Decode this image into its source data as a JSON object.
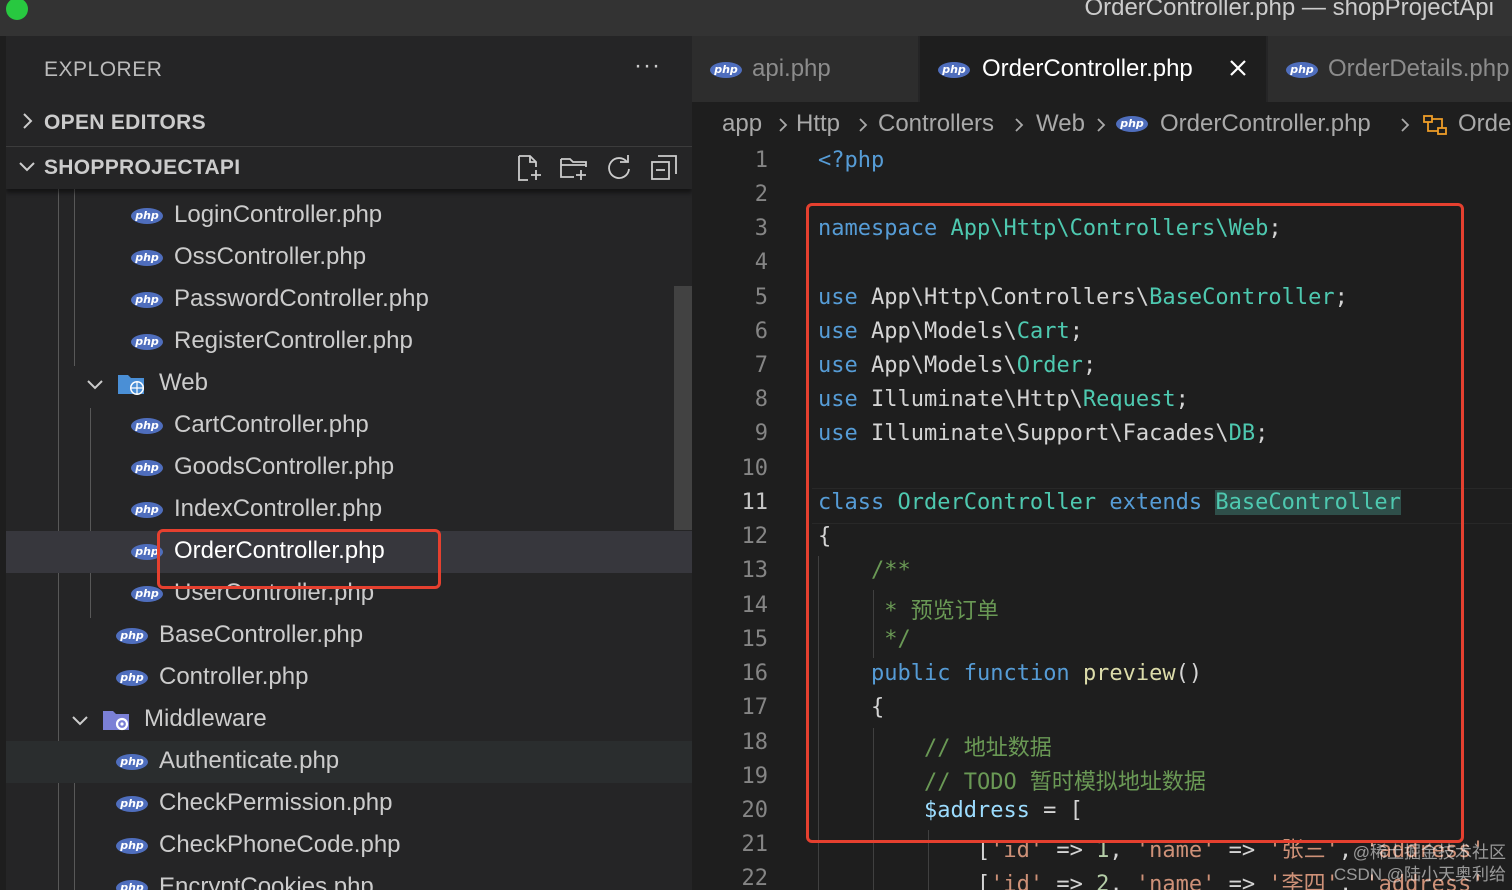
{
  "window": {
    "title": "OrderController.php — shopProjectApi"
  },
  "sidebar": {
    "title": "EXPLORER",
    "more": "···",
    "open_editors": "OPEN EDITORS",
    "project": "SHOPPROJECTAPI",
    "toolbar": [
      "new-file-icon",
      "new-folder-icon",
      "refresh-icon",
      "collapse-all-icon"
    ],
    "tree": [
      {
        "label": "LoginController.php",
        "type": "file"
      },
      {
        "label": "OssController.php",
        "type": "file"
      },
      {
        "label": "PasswordController.php",
        "type": "file"
      },
      {
        "label": "RegisterController.php",
        "type": "file"
      },
      {
        "label": "Web",
        "type": "folder",
        "expanded": true
      },
      {
        "label": "CartController.php",
        "type": "file"
      },
      {
        "label": "GoodsController.php",
        "type": "file"
      },
      {
        "label": "IndexController.php",
        "type": "file"
      },
      {
        "label": "OrderController.php",
        "type": "file",
        "selected": true
      },
      {
        "label": "UserController.php",
        "type": "file"
      },
      {
        "label": "BaseController.php",
        "type": "file"
      },
      {
        "label": "Controller.php",
        "type": "file"
      },
      {
        "label": "Middleware",
        "type": "folder",
        "expanded": true
      },
      {
        "label": "Authenticate.php",
        "type": "file"
      },
      {
        "label": "CheckPermission.php",
        "type": "file"
      },
      {
        "label": "CheckPhoneCode.php",
        "type": "file"
      },
      {
        "label": "EncryptCookies.php",
        "type": "file"
      }
    ]
  },
  "tabs": [
    {
      "label": "api.php",
      "active": false
    },
    {
      "label": "OrderController.php",
      "active": true
    },
    {
      "label": "OrderDetails.php",
      "active": false
    }
  ],
  "breadcrumbs": [
    "app",
    "Http",
    "Controllers",
    "Web",
    "OrderController.php",
    "OrderController"
  ],
  "editor": {
    "current_line": 11,
    "line_numbers": [
      "1",
      "2",
      "3",
      "4",
      "5",
      "6",
      "7",
      "8",
      "9",
      "10",
      "11",
      "12",
      "13",
      "14",
      "15",
      "16",
      "17",
      "18",
      "19",
      "20",
      "21",
      "22"
    ],
    "code": {
      "l1": "<?php",
      "l3_kw": "namespace",
      "l3_ns": "App\\Http\\Controllers\\Web",
      "l5_path": "App\\Http\\Controllers\\",
      "l5_cls": "BaseController",
      "l6_path": "App\\Models\\",
      "l6_cls": "Cart",
      "l7_path": "App\\Models\\",
      "l7_cls": "Order",
      "l8_path": "Illuminate\\Http\\",
      "l8_cls": "Request",
      "l9_path": "Illuminate\\Support\\Facades\\",
      "l9_cls": "DB",
      "use": "use",
      "l11_class": "class",
      "l11_name": "OrderController",
      "l11_extends": "extends",
      "l11_base": "BaseController",
      "l12": "{",
      "l13": "/**",
      "l14": "* 预览订单",
      "l15": "*/",
      "l16_public": "public",
      "l16_function": "function",
      "l16_name": "preview",
      "l17": "{",
      "l18": "// 地址数据",
      "l19": "// TODO 暂时模拟地址数据",
      "l20_var": "$address",
      "l21_id": "'id'",
      "l21_idv": "1",
      "l21_name": "'name'",
      "l21_namev": "'张三'",
      "l21_addr": "'address'",
      "l22_id": "'id'",
      "l22_idv": "2",
      "l22_name": "'name'",
      "l22_namev": "'李四'",
      "l22_addr": "'address'"
    }
  },
  "watermark": [
    "@稀土掘金技术社区",
    "CSDN @陆小天奥利给"
  ],
  "colors": {
    "highlight": "#e5402f",
    "php_icon": "#4f6ebd",
    "keyword": "#569cd6",
    "type": "#4ec9b0"
  }
}
